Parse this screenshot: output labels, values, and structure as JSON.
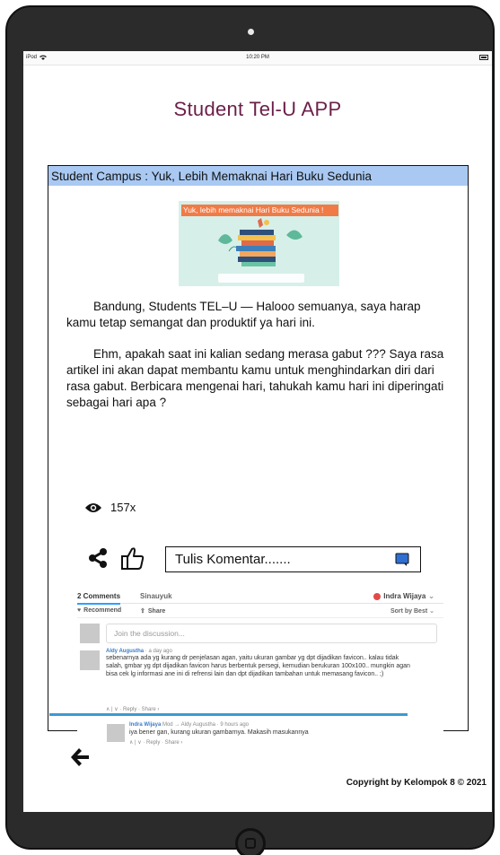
{
  "status_bar": {
    "device": "iPod",
    "time": "10:20 PM"
  },
  "app": {
    "title": "Student Tel-U APP"
  },
  "article": {
    "header": "Student Campus : Yuk, Lebih Memaknai Hari Buku Sedunia",
    "image_banner": "Yuk, lebih memaknai Hari Buku Sedunia !",
    "paragraph_1": "Bandung, Students TEL–U — Halooo semuanya, saya harap kamu tetap semangat dan produktif ya hari ini.",
    "paragraph_2": "Ehm, apakah saat ini kalian sedang merasa gabut ??? Saya rasa artikel ini akan dapat membantu kamu untuk menghindarkan diri dari rasa gabut. Berbicara mengenai hari, tahukah kamu hari ini diperingati sebagai hari apa ?",
    "views": "157x"
  },
  "comment_input": {
    "placeholder": "Tulis Komentar......."
  },
  "disqus": {
    "comments_tab": "2 Comments",
    "site_tab": "Sinauyuk",
    "user": "Indra Wijaya",
    "recommend": "Recommend",
    "share": "Share",
    "sort": "Sort by Best",
    "join_placeholder": "Join the discussion...",
    "comments": [
      {
        "author": "Aldy Augustha",
        "meta": " · a day ago",
        "text": "sebenarnya ada yg kurang dr penjelasan agan, yaitu ukuran gambar yg dpt dijadikan favicon.. kalau tidak salah, gmbar yg dpt dijadikan favicon harus berbentuk persegi, kemudian berukuran 100x100.. mungkin agan bisa cek lg informasi ane ini di refrensi lain dan dpt dijadikan tambahan untuk memasang favicon.. ;)",
        "actions": "∧ | ∨ · Reply · Share ›"
      },
      {
        "author": "Indra Wijaya",
        "meta": " Mod → Aldy Augustha · 9 hours ago",
        "text": "iya bener gan, kurang ukuran gambarnya. Makasih masukannya",
        "actions": "∧ | ∨ · Reply · Share ›"
      }
    ]
  },
  "footer": {
    "copyright": "Copyright by Kelompok 8 © 2021"
  },
  "colors": {
    "title": "#6b1f49",
    "header_bg": "#a9c9f2",
    "disqus_accent": "#2e9fff"
  }
}
